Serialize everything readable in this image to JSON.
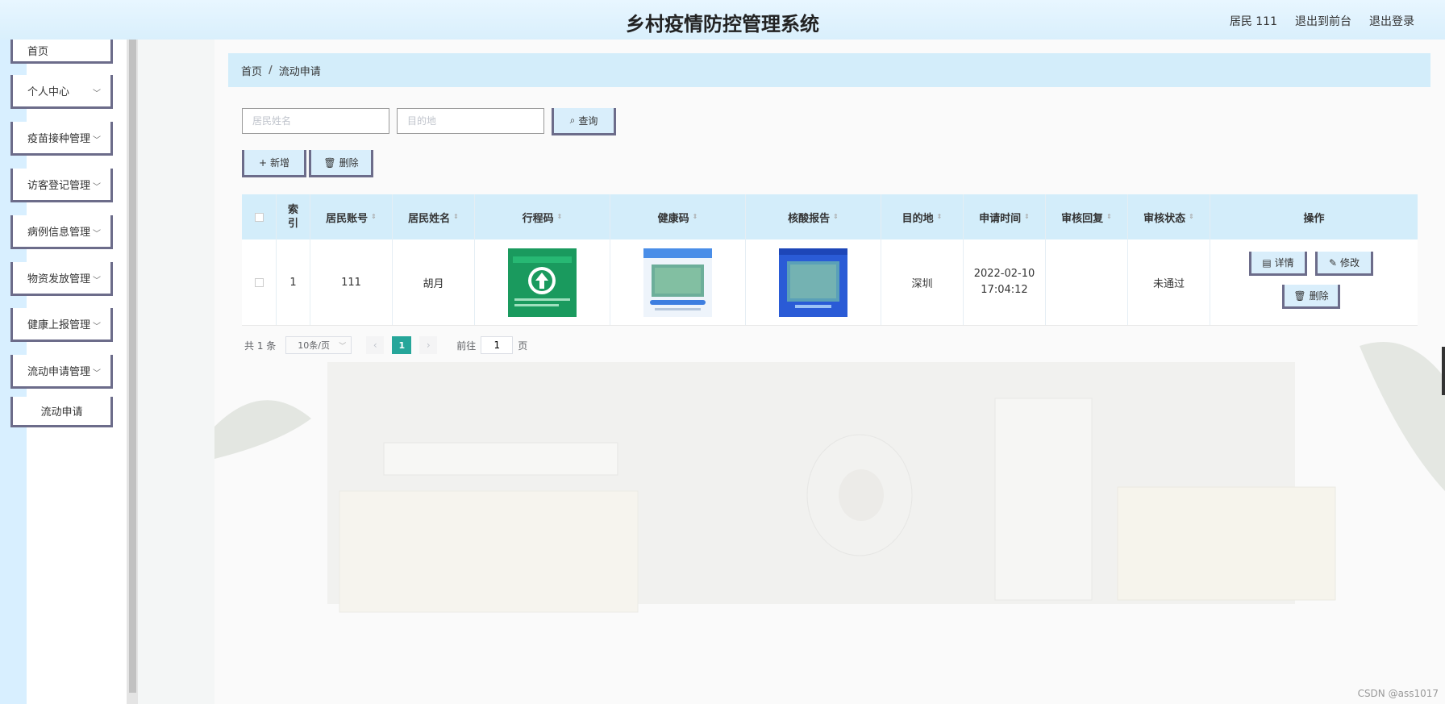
{
  "header": {
    "title": "乡村疫情防控管理系统",
    "user": "居民 111",
    "to_front": "退出到前台",
    "logout": "退出登录"
  },
  "sidebar": {
    "items": [
      {
        "label": "首页"
      },
      {
        "label": "个人中心"
      },
      {
        "label": "疫苗接种管理"
      },
      {
        "label": "访客登记管理"
      },
      {
        "label": "病例信息管理"
      },
      {
        "label": "物资发放管理"
      },
      {
        "label": "健康上报管理"
      },
      {
        "label": "流动申请管理"
      },
      {
        "label": "流动申请"
      }
    ]
  },
  "breadcrumb": {
    "home": "首页",
    "separator": "/",
    "current": "流动申请"
  },
  "search": {
    "name_placeholder": "居民姓名",
    "dest_placeholder": "目的地",
    "query_label": "查询"
  },
  "toolbar": {
    "add_label": "新增",
    "delete_label": "删除"
  },
  "table": {
    "headers": [
      "索引",
      "居民账号",
      "居民姓名",
      "行程码",
      "健康码",
      "核酸报告",
      "目的地",
      "申请时间",
      "审核回复",
      "审核状态",
      "操作"
    ],
    "rows": [
      {
        "index": "1",
        "account": "111",
        "name": "胡月",
        "destination": "深圳",
        "apply_date": "2022-02-10",
        "apply_time": "17:04:12",
        "reply": "",
        "status": "未通过",
        "detail_label": "详情",
        "edit_label": "修改",
        "delete_label": "删除"
      }
    ]
  },
  "pagination": {
    "total": "共 1 条",
    "page_size": "10条/页",
    "current_page": "1",
    "goto_prefix": "前往",
    "goto_value": "1",
    "goto_suffix": "页"
  },
  "watermark": "CSDN @ass1017",
  "colors": {
    "accent": "#26a69a",
    "header_bg": "#d9effc",
    "table_header": "#d3edfa",
    "button_border": "#6c6c8a"
  }
}
